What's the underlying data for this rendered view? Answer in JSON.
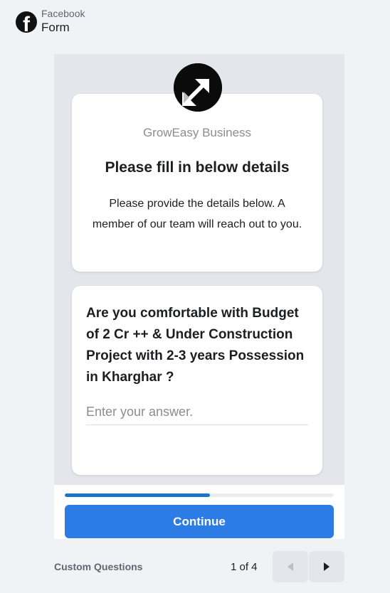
{
  "header": {
    "platform": "Facebook",
    "title": "Form"
  },
  "intro_card": {
    "business_name": "GrowEasy Business",
    "title": "Please fill in below details",
    "description": "Please provide the details below. A member of our team will reach out to you."
  },
  "question_card": {
    "question": "Are you comfortable with Budget of 2 Cr ++ & Under Construction Project with 2-3 years Possession in Kharghar ?",
    "answer_value": "",
    "answer_placeholder": "Enter your answer."
  },
  "progress": {
    "fraction": 0.54,
    "color": "#1877c9"
  },
  "continue_label": "Continue",
  "footer": {
    "section_label": "Custom Questions",
    "page_indicator": "1 of 4"
  },
  "colors": {
    "accent": "#2d7be5",
    "background": "#f0f2f5"
  }
}
